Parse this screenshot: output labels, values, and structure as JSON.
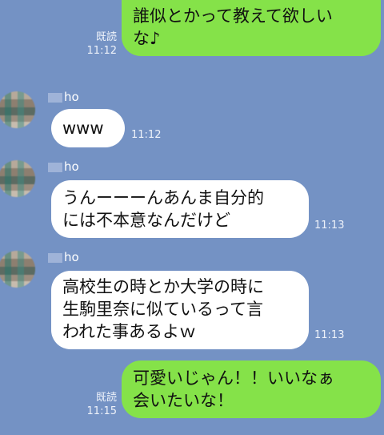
{
  "messages": [
    {
      "lines": [
        "誰似とかって教えて欲しい",
        "な♪"
      ],
      "read": "既読",
      "time": "11:12"
    },
    {
      "sender": "ho",
      "lines": [
        "www"
      ],
      "time": "11:12"
    },
    {
      "sender": "ho",
      "lines": [
        "うんーーーんあんま自分的",
        "には不本意なんだけど"
      ],
      "time": "11:13"
    },
    {
      "sender": "ho",
      "lines": [
        "高校生の時とか大学の時に",
        "生駒里奈に似ているって言",
        "われた事あるよｗ"
      ],
      "time": "11:13"
    },
    {
      "lines": [
        "可愛いじゃん！！いいなぁ",
        "会いたいな！"
      ],
      "read": "既読",
      "time": "11:15"
    }
  ],
  "colors": {
    "background": "#7492c4",
    "sent_bubble": "#85e249",
    "received_bubble": "#ffffff"
  }
}
